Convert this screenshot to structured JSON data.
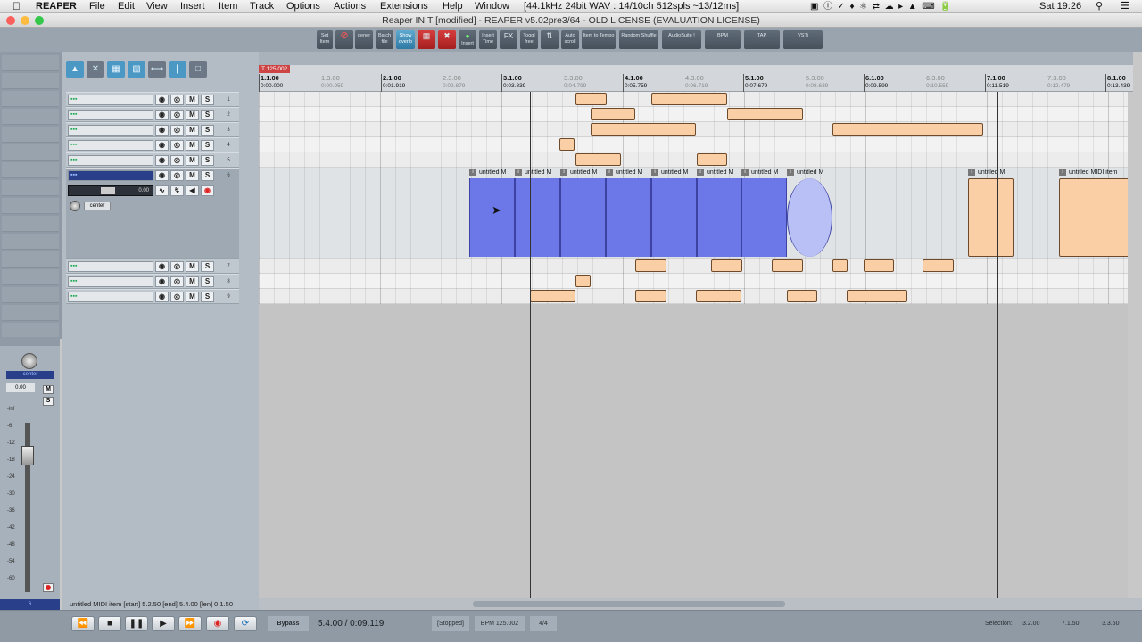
{
  "menubar": {
    "apple": "",
    "app_name": "REAPER",
    "items": [
      "File",
      "Edit",
      "View",
      "Insert",
      "Item",
      "Track",
      "Options",
      "Actions",
      "Extensions",
      "Help",
      "Window"
    ],
    "audio_info": "[44.1kHz 24bit WAV : 14/10ch 512spls ~13/12ms]",
    "clock": "Sat 19:26"
  },
  "window": {
    "title": "Reaper INIT [modified] - REAPER v5.02pre3/64 - OLD LICENSE (EVALUATION LICENSE)"
  },
  "toolbar": {
    "buttons": [
      {
        "label": "Set Item",
        "state": "normal"
      },
      {
        "label": "",
        "state": "red-icon"
      },
      {
        "label": "gener",
        "state": "normal"
      },
      {
        "label": "Batch file",
        "state": "normal"
      },
      {
        "label": "Show overlo",
        "state": "active"
      },
      {
        "label": "",
        "state": "red"
      },
      {
        "label": "",
        "state": "red"
      },
      {
        "label": "Insert",
        "state": "normal"
      },
      {
        "label": "Insert Time",
        "state": "normal"
      },
      {
        "label": "FX",
        "state": "normal"
      },
      {
        "label": "Toggl free",
        "state": "normal"
      },
      {
        "label": "",
        "state": "normal"
      },
      {
        "label": "Auto scroll",
        "state": "normal"
      },
      {
        "label": "Item to Tempo",
        "state": "normal"
      },
      {
        "label": "Random Shuffle",
        "state": "normal"
      },
      {
        "label": "AudioSuite !",
        "state": "normal"
      },
      {
        "label": "BPM",
        "state": "normal"
      },
      {
        "label": "TAP",
        "state": "normal"
      },
      {
        "label": "VSTi",
        "state": "normal"
      }
    ]
  },
  "tracks": [
    {
      "num": "1",
      "selected": false
    },
    {
      "num": "2",
      "selected": false
    },
    {
      "num": "3",
      "selected": false
    },
    {
      "num": "4",
      "selected": false
    },
    {
      "num": "5",
      "selected": false
    },
    {
      "num": "6",
      "selected": true,
      "volume": "0.00",
      "pan": "center"
    },
    {
      "num": "7",
      "selected": false
    },
    {
      "num": "8",
      "selected": false
    },
    {
      "num": "9",
      "selected": false
    }
  ],
  "track_buttons": {
    "mute": "M",
    "solo": "S"
  },
  "ruler": {
    "tempo_marker": "125.002",
    "bars": [
      {
        "bar": "1.1.00",
        "time": "0:00.000"
      },
      {
        "bar": "2.1.00",
        "time": "0:01.919"
      },
      {
        "bar": "3.1.00",
        "time": "0:03.839"
      },
      {
        "bar": "4.1.00",
        "time": "0:05.759"
      },
      {
        "bar": "5.1.00",
        "time": "0:07.679"
      },
      {
        "bar": "6.1.00",
        "time": "0:09.599"
      },
      {
        "bar": "7.1.00",
        "time": "0:11.519"
      },
      {
        "bar": "8.1.00",
        "time": "0:13.439"
      }
    ],
    "beats": [
      {
        "bar": "1.3.00",
        "time": "0:00.959"
      },
      {
        "bar": "2.3.00",
        "time": "0:02.879"
      },
      {
        "bar": "3.3.00",
        "time": "0:04.799"
      },
      {
        "bar": "4.3.00",
        "time": "0:06.719"
      },
      {
        "bar": "5.3.00",
        "time": "0:08.639"
      },
      {
        "bar": "6.3.00",
        "time": "0:10.559"
      },
      {
        "bar": "7.3.00",
        "time": "0:12.479"
      }
    ]
  },
  "midi_items": {
    "label": "untitled M",
    "last_label": "untitled MIDI item"
  },
  "mixer": {
    "volume": "0.00",
    "pan": "center",
    "mute": "M",
    "solo": "S",
    "scale": [
      "-inf",
      "-6",
      "-12",
      "-18",
      "-24",
      "-30",
      "-36",
      "-42",
      "-48",
      "-54",
      "-60"
    ],
    "track_num": "6"
  },
  "status": {
    "item_info": "untitled MIDI item [start] 5.2.50 [end] 5.4.00 [len] 0.1.50"
  },
  "transport": {
    "bypass": "Bypass",
    "position": "5.4.00 / 0:09.119",
    "state": "[Stopped]",
    "bpm": "BPM 125.002",
    "timesig": "4/4",
    "selection_label": "Selection:",
    "sel_start": "3.2.00",
    "sel_end": "7.1.50",
    "sel_len": "3.3.50"
  }
}
